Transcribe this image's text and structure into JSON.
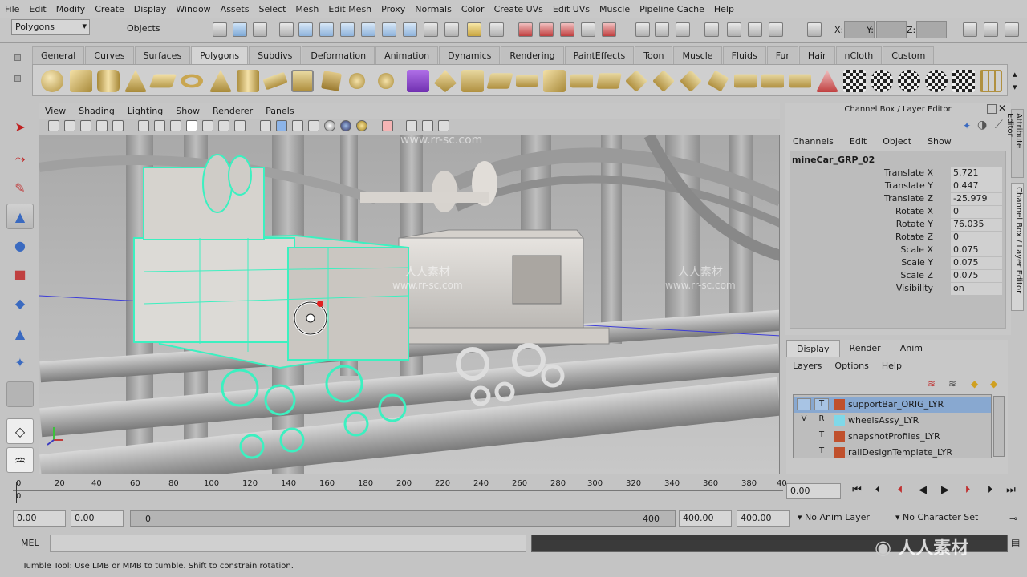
{
  "menubar": [
    "File",
    "Edit",
    "Modify",
    "Create",
    "Display",
    "Window",
    "Assets",
    "Select",
    "Mesh",
    "Edit Mesh",
    "Proxy",
    "Normals",
    "Color",
    "Create UVs",
    "Edit UVs",
    "Muscle",
    "Pipeline Cache",
    "Help"
  ],
  "statusline": {
    "mode": "Polygons",
    "selection_mask": "Objects",
    "x_label": "X:",
    "y_label": "Y:",
    "z_label": "Z:"
  },
  "shelf_tabs": [
    "General",
    "Curves",
    "Surfaces",
    "Polygons",
    "Subdivs",
    "Deformation",
    "Animation",
    "Dynamics",
    "Rendering",
    "PaintEffects",
    "Toon",
    "Muscle",
    "Fluids",
    "Fur",
    "Hair",
    "nCloth",
    "Custom"
  ],
  "shelf_active": "Polygons",
  "panel_menu": [
    "View",
    "Shading",
    "Lighting",
    "Show",
    "Renderer",
    "Panels"
  ],
  "channel_box": {
    "title": "Channel Box / Layer Editor",
    "menu": [
      "Channels",
      "Edit",
      "Object",
      "Show"
    ],
    "object": "mineCar_GRP_02",
    "channels": [
      {
        "label": "Translate X",
        "value": "5.721"
      },
      {
        "label": "Translate Y",
        "value": "0.447"
      },
      {
        "label": "Translate Z",
        "value": "-25.979"
      },
      {
        "label": "Rotate X",
        "value": "0"
      },
      {
        "label": "Rotate Y",
        "value": "76.035"
      },
      {
        "label": "Rotate Z",
        "value": "0"
      },
      {
        "label": "Scale X",
        "value": "0.075"
      },
      {
        "label": "Scale Y",
        "value": "0.075"
      },
      {
        "label": "Scale Z",
        "value": "0.075"
      },
      {
        "label": "Visibility",
        "value": "on"
      }
    ]
  },
  "side_tabs": [
    "Attribute Editor",
    "Channel Box / Layer Editor"
  ],
  "layer_editor": {
    "tabs": [
      "Display",
      "Render",
      "Anim"
    ],
    "menu": [
      "Layers",
      "Options",
      "Help"
    ],
    "layers": [
      {
        "v": "",
        "t": "T",
        "color": "#c0502c",
        "name": "supportBar_ORIG_LYR",
        "selected": true
      },
      {
        "v": "V",
        "t": "R",
        "color": "#7fd8e8",
        "name": "wheelsAssy_LYR",
        "selected": false
      },
      {
        "v": "",
        "t": "T",
        "color": "#c0502c",
        "name": "snapshotProfiles_LYR",
        "selected": false
      },
      {
        "v": "",
        "t": "T",
        "color": "#c0502c",
        "name": "railDesignTemplate_LYR",
        "selected": false
      }
    ]
  },
  "timeline": {
    "labels": [
      "0",
      "20",
      "40",
      "60",
      "80",
      "100",
      "120",
      "140",
      "160",
      "180",
      "200",
      "220",
      "240",
      "260",
      "280",
      "300",
      "320",
      "340",
      "360",
      "380",
      "40"
    ],
    "current_frame": "0",
    "current_time": "0.00"
  },
  "range": {
    "start": "0.00",
    "playback_start": "0.00",
    "slider_left": "0",
    "slider_right": "400",
    "playback_end": "400.00",
    "end": "400.00",
    "anim_layer": "No Anim Layer",
    "character_set": "No Character Set"
  },
  "mel_label": "MEL",
  "help_text": "Tumble Tool: Use LMB or MMB to tumble. Shift to constrain rotation.",
  "watermark": {
    "url": "www.rr-sc.com",
    "cn": "人人素材"
  },
  "colors": {
    "selected_wire": "#3cf0c0",
    "accent": "#88a8d0"
  }
}
